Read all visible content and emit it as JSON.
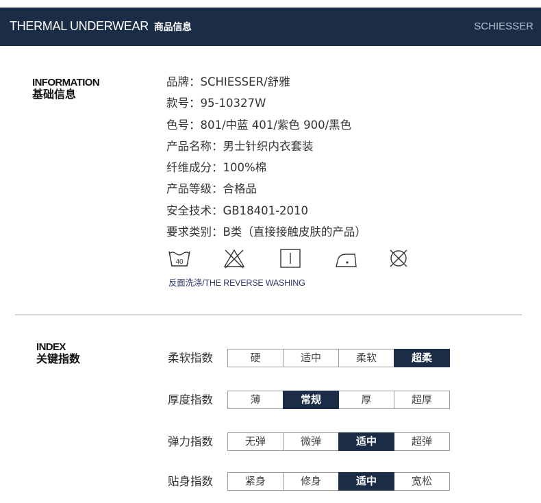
{
  "header": {
    "title_en": "THERMAL UNDERWEAR",
    "title_cn": "商品信息",
    "brand": "SCHIESSER"
  },
  "information": {
    "label_en": "INFORMATION",
    "label_cn": "基础信息",
    "items": [
      "品牌：SCHIESSER/舒雅",
      "款号：95-10327W",
      "色号：801/中蓝 401/紫色 900/黑色",
      "产品名称：男士针织内衣套装",
      "纤维成分：100%棉",
      "产品等级：合格品",
      "安全技术：GB18401-2010",
      "要求类别：B类（直接接触皮肤的产品）"
    ],
    "care_icons": [
      {
        "icon": "wash-40-icon",
        "text": "40"
      },
      {
        "icon": "no-bleach-icon"
      },
      {
        "icon": "line-dry-icon"
      },
      {
        "icon": "iron-low-icon"
      },
      {
        "icon": "no-dry-clean-icon"
      }
    ],
    "wash_note": "反面洗涤/THE REVERSE WASHING"
  },
  "index": {
    "label_en": "INDEX",
    "label_cn": "关键指数",
    "rows": [
      {
        "label": "柔软指数",
        "options": [
          "硬",
          "适中",
          "柔软",
          "超柔"
        ],
        "active": 3
      },
      {
        "label": "厚度指数",
        "options": [
          "薄",
          "常规",
          "厚",
          "超厚"
        ],
        "active": 1
      },
      {
        "label": "弹力指数",
        "options": [
          "无弹",
          "微弹",
          "适中",
          "超弹"
        ],
        "active": 2
      },
      {
        "label": "贴身指数",
        "options": [
          "紧身",
          "修身",
          "适中",
          "宽松"
        ],
        "active": 2
      }
    ]
  },
  "colors": {
    "header_bg": "#1b2c47",
    "active_cell": "#1b2c47",
    "wash_note": "#2f3a6b"
  }
}
